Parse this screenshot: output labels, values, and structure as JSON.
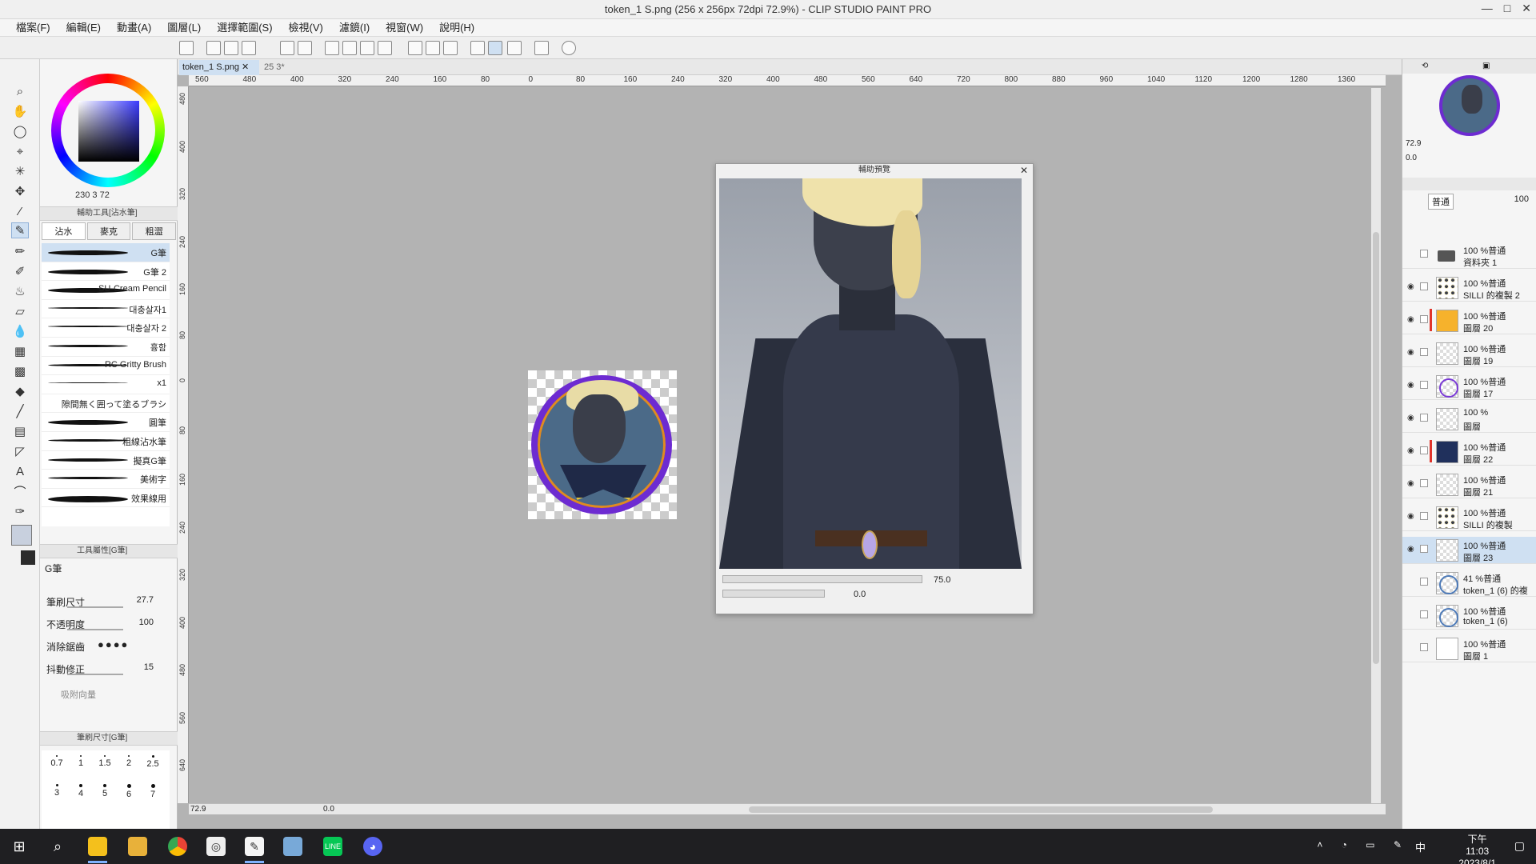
{
  "window": {
    "title": "token_1 S.png (256 x 256px 72dpi 72.9%)  - CLIP STUDIO PAINT PRO",
    "controls": [
      "—",
      "□",
      "✕"
    ]
  },
  "menu": [
    "檔案(F)",
    "編輯(E)",
    "動畫(A)",
    "圖層(L)",
    "選擇範圍(S)",
    "檢視(V)",
    "濾鏡(I)",
    "視窗(W)",
    "說明(H)"
  ],
  "colors": {
    "accent": "#cfe0f2",
    "main_color": "#c8d0de",
    "sub_color": "#2b2b2b",
    "layer_mark": "#e0342b"
  },
  "color_panel": {
    "readout": "230  3  72"
  },
  "subtool": {
    "header": "輔助工具[沾水筆]",
    "tabs": [
      "沾水",
      "麥克",
      "粗澀"
    ],
    "brushes": [
      "G筆",
      "G筆 2",
      "SU-Cream Pencil",
      "대충살자1",
      "대충살자 2",
      "흉함",
      "RC Gritty Brush",
      "x1",
      "隙間無く囲って塗るブラシ",
      "圓筆",
      "粗線沾水筆",
      "擬真G筆",
      "美術字",
      "效果線用"
    ]
  },
  "tool_property": {
    "header": "工具屬性[G筆]",
    "brush_name": "G筆",
    "brush_size_label": "筆刷尺寸",
    "brush_size": "27.7",
    "opacity_label": "不透明度",
    "opacity": "100",
    "antialias_label": "消除鋸齒",
    "stabilization_label": "抖動修正",
    "stabilization": "15",
    "snap_label": "吸附向量"
  },
  "brush_size_panel": {
    "header": "筆刷尺寸[G筆]",
    "sizes": [
      "0.7",
      "1",
      "1.5",
      "2",
      "2.5",
      "3",
      "4",
      "5",
      "6",
      "7"
    ]
  },
  "document": {
    "tab": "token_1 S.png",
    "tab2": "25 3*",
    "ruler_h": [
      "560",
      "480",
      "400",
      "320",
      "240",
      "160",
      "80",
      "0",
      "80",
      "160",
      "240",
      "320",
      "400",
      "480",
      "560",
      "640",
      "720",
      "800",
      "880",
      "960",
      "1040",
      "1120",
      "1200",
      "1280",
      "1360"
    ],
    "ruler_v": [
      "480",
      "400",
      "320",
      "240",
      "160",
      "80",
      "0",
      "80",
      "160",
      "240",
      "320",
      "400",
      "480",
      "560",
      "640"
    ],
    "zoom": "72.9",
    "rotation": "0.0"
  },
  "sub_view": {
    "title": "輔助預覽",
    "zoom": "75.0",
    "rotation": "0.0"
  },
  "navigator": {
    "zoom": "72.9",
    "rotation": "0.0"
  },
  "layer_panel": {
    "blend_mode": "普通",
    "opacity": "100",
    "layers": [
      {
        "opacity_blend": "100 %普通",
        "name": "資料夾 1",
        "thumb": "folder",
        "visible": false,
        "selected": false,
        "marked": false
      },
      {
        "opacity_blend": "100 %普通",
        "name": "SILLI 的複製 2",
        "thumb": "portrait",
        "visible": true,
        "selected": false,
        "marked": false
      },
      {
        "opacity_blend": "100 %普通",
        "name": "圖層 20",
        "thumb": "orange",
        "visible": true,
        "selected": false,
        "marked": true
      },
      {
        "opacity_blend": "100 %普通",
        "name": "圖層 19",
        "thumb": "blank",
        "visible": true,
        "selected": false,
        "marked": false
      },
      {
        "opacity_blend": "100 %普通",
        "name": "圖層 17",
        "thumb": "violet",
        "visible": true,
        "selected": false,
        "marked": false
      },
      {
        "opacity_blend": "100 %",
        "name": "圖層",
        "thumb": "blank",
        "visible": true,
        "selected": false,
        "marked": false
      },
      {
        "opacity_blend": "100 %普通",
        "name": "圖層 22",
        "thumb": "navy",
        "visible": true,
        "selected": false,
        "marked": true
      },
      {
        "opacity_blend": "100 %普通",
        "name": "圖層 21",
        "thumb": "blank",
        "visible": true,
        "selected": false,
        "marked": false
      },
      {
        "opacity_blend": "100 %普通",
        "name": "SILLI 的複製",
        "thumb": "portrait",
        "visible": true,
        "selected": false,
        "marked": false
      },
      {
        "opacity_blend": "100 %普通",
        "name": "圖層 23",
        "thumb": "blank",
        "visible": true,
        "selected": true,
        "marked": false
      },
      {
        "opacity_blend": "41 %普通",
        "name": "token_1 (6) 的複",
        "thumb": "circle",
        "visible": false,
        "selected": false,
        "marked": false
      },
      {
        "opacity_blend": "100 %普通",
        "name": "token_1 (6)",
        "thumb": "circle",
        "visible": false,
        "selected": false,
        "marked": false
      },
      {
        "opacity_blend": "100 %普通",
        "name": "圖層 1",
        "thumb": "white",
        "visible": false,
        "selected": false,
        "marked": false
      }
    ]
  },
  "taskbar": {
    "apps": [
      "windows-start",
      "search",
      "sticky-notes",
      "file-explorer",
      "chrome",
      "clip-studio",
      "clip-studio-paint",
      "notepad",
      "line",
      "discord"
    ],
    "ime": "中",
    "time": "下午 11:03",
    "date": "2023/8/1"
  }
}
